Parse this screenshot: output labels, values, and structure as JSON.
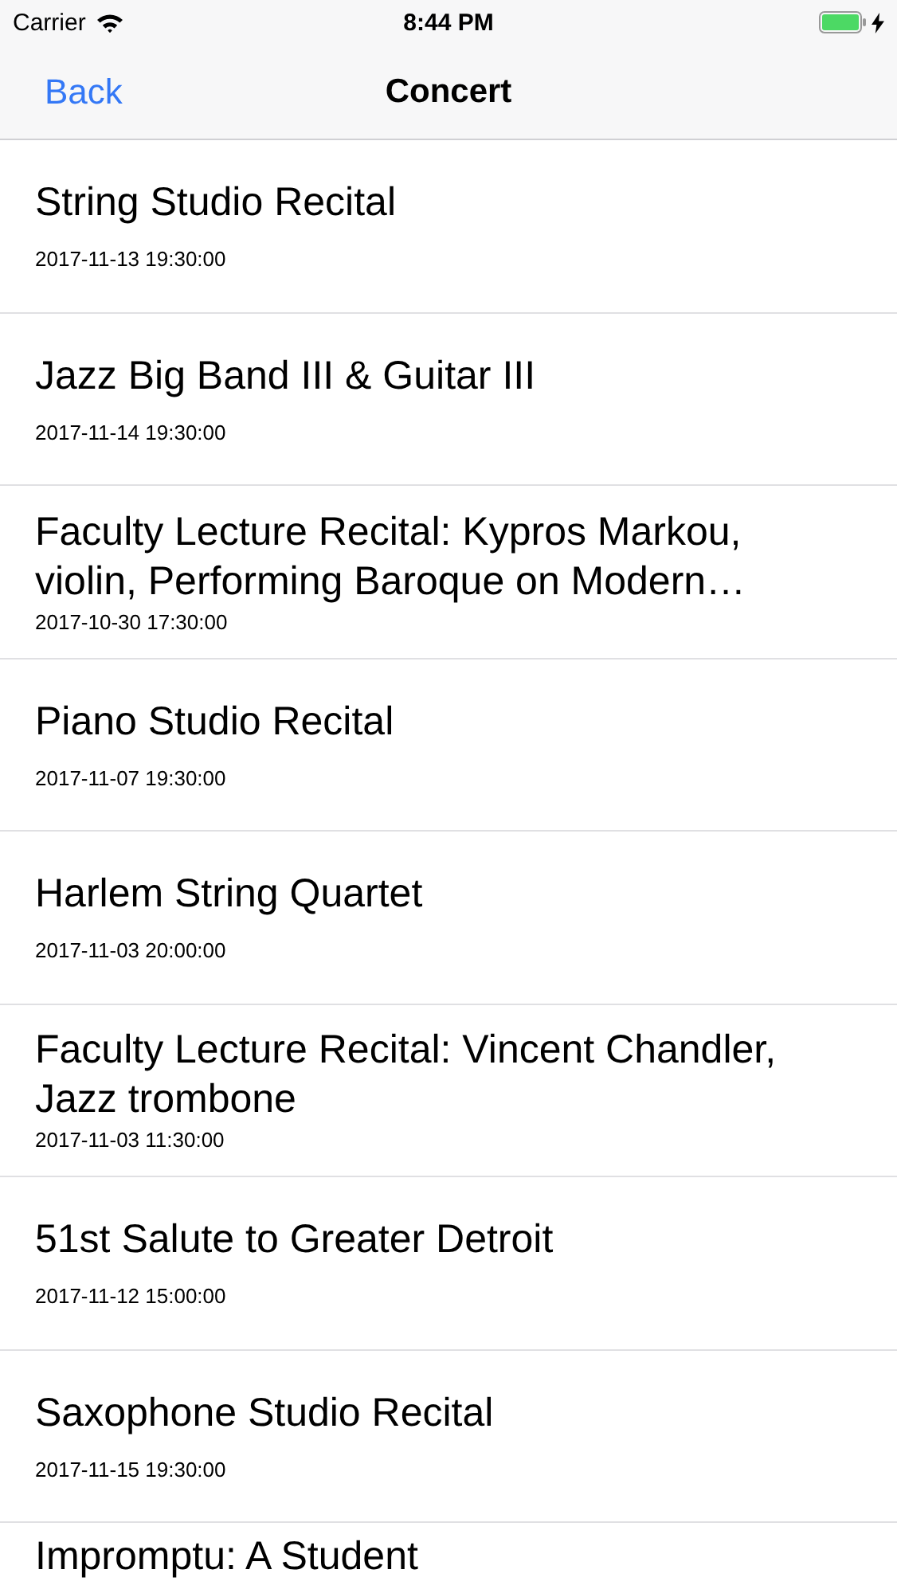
{
  "status_bar": {
    "carrier": "Carrier",
    "time": "8:44 PM"
  },
  "nav_bar": {
    "back": "Back",
    "title": "Concert"
  },
  "concerts": [
    {
      "title": "String Studio Recital",
      "date": "2017-11-13 19:30:00"
    },
    {
      "title": "Jazz Big Band III & Guitar III",
      "date": "2017-11-14 19:30:00"
    },
    {
      "title": "Faculty Lecture Recital: Kypros Markou, violin, Performing Baroque on Modern…",
      "date": "2017-10-30 17:30:00"
    },
    {
      "title": "Piano Studio Recital",
      "date": "2017-11-07 19:30:00"
    },
    {
      "title": "Harlem String Quartet",
      "date": "2017-11-03 20:00:00"
    },
    {
      "title": "Faculty Lecture Recital: Vincent Chandler, Jazz trombone",
      "date": "2017-11-03 11:30:00"
    },
    {
      "title": "51st Salute to Greater Detroit",
      "date": "2017-11-12 15:00:00"
    },
    {
      "title": "Saxophone Studio Recital",
      "date": "2017-11-15 19:30:00"
    },
    {
      "title": "Impromptu: A Student"
    }
  ]
}
